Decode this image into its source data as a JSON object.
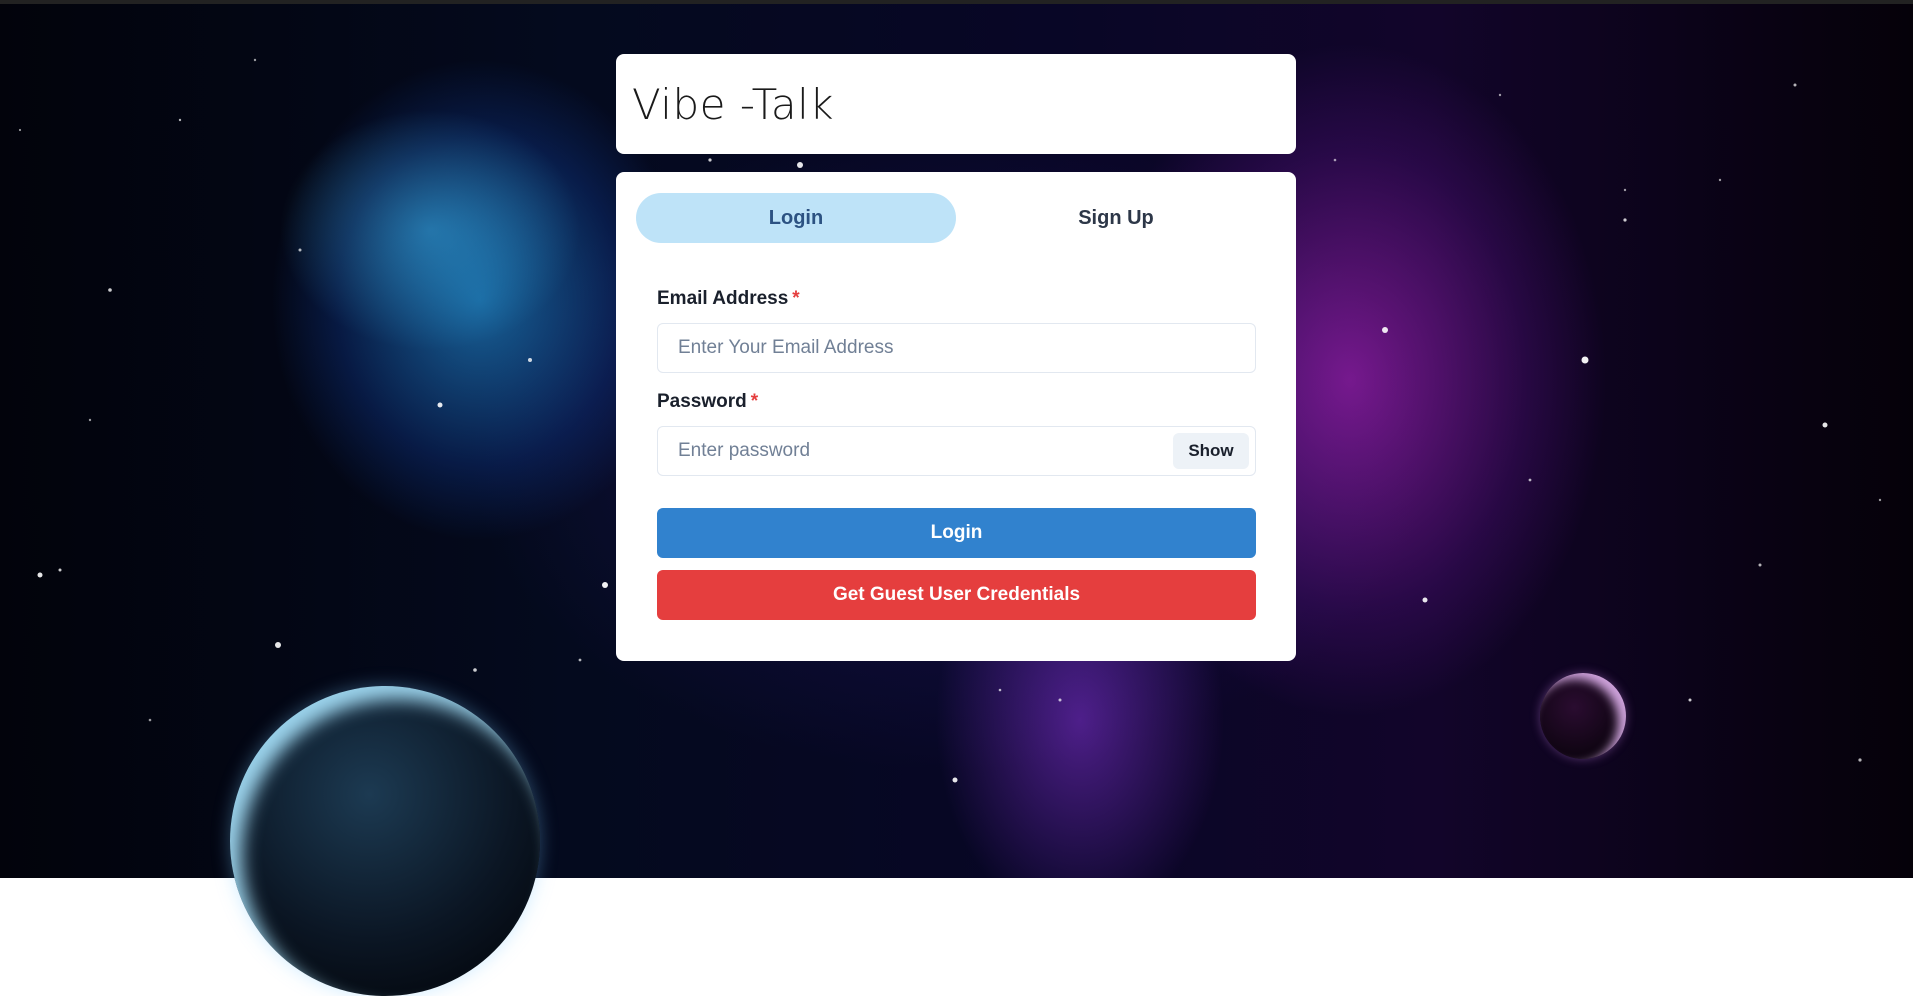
{
  "app": {
    "title": "Vibe -Talk"
  },
  "tabs": [
    {
      "label": "Login",
      "active": true
    },
    {
      "label": "Sign Up",
      "active": false
    }
  ],
  "form": {
    "email": {
      "label": "Email Address",
      "required_mark": "*",
      "placeholder": "Enter Your Email Address",
      "value": ""
    },
    "password": {
      "label": "Password",
      "required_mark": "*",
      "placeholder": "Enter password",
      "value": "",
      "toggle_label": "Show"
    },
    "login_button": "Login",
    "guest_button": "Get Guest User Credentials"
  },
  "colors": {
    "tab_active_bg": "#bee3f8",
    "primary": "#3182ce",
    "danger": "#e53e3e",
    "required": "#e53e3e"
  }
}
